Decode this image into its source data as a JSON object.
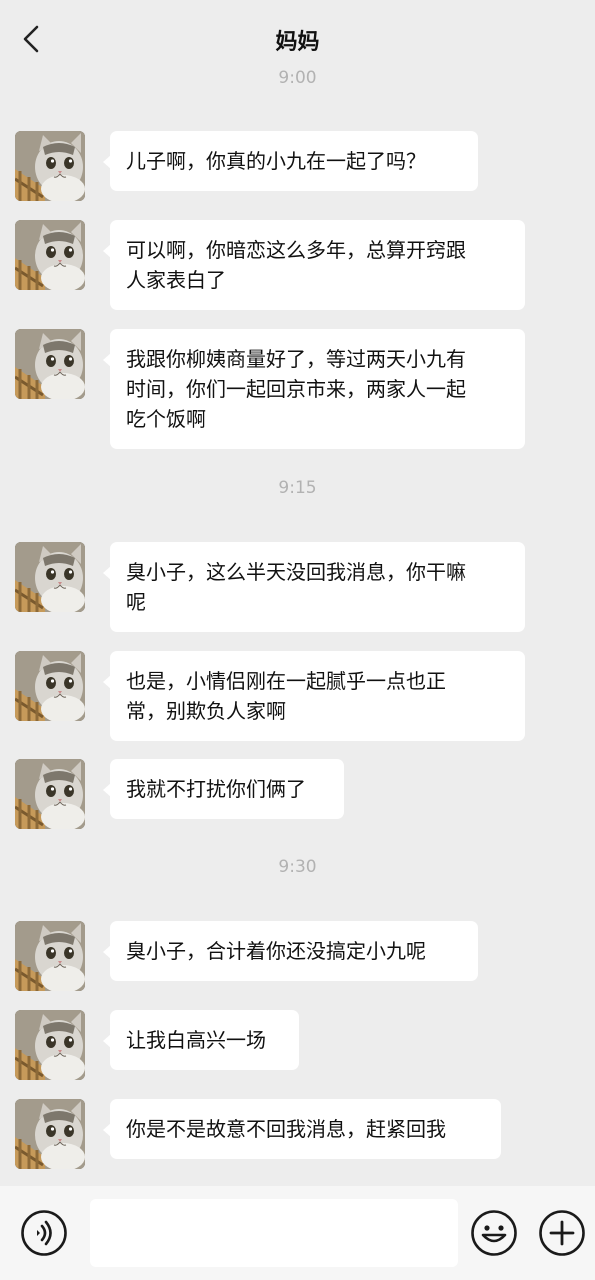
{
  "header": {
    "title": "妈妈"
  },
  "times": [
    "9:00",
    "9:15",
    "9:30"
  ],
  "messages": [
    {
      "text": "儿子啊，你真的小九在一起了吗？"
    },
    {
      "text": "可以啊，你暗恋这么多年，总算开窍跟\n人家表白了"
    },
    {
      "text": "我跟你柳姨商量好了，等过两天小九有\n时间，你们一起回京市来，两家人一起\n吃个饭啊"
    },
    {
      "text": "臭小子，这么半天没回我消息，你干嘛\n呢"
    },
    {
      "text": "也是，小情侣刚在一起腻乎一点也正\n常，别欺负人家啊"
    },
    {
      "text": "我就不打扰你们俩了"
    },
    {
      "text": "臭小子，合计着你还没搞定小九呢"
    },
    {
      "text": "让我白高兴一场"
    },
    {
      "text": "你是不是故意不回我消息，赶紧回我"
    }
  ],
  "icons": {
    "back": "back-arrow-icon",
    "voice": "voice-icon",
    "emoji": "emoji-icon",
    "plus": "plus-icon",
    "avatar": "cat-avatar"
  },
  "colors": {
    "background": "#ededed",
    "bubble": "#ffffff",
    "time_text": "#b2b2b2",
    "input_bar": "#f6f6f6"
  }
}
